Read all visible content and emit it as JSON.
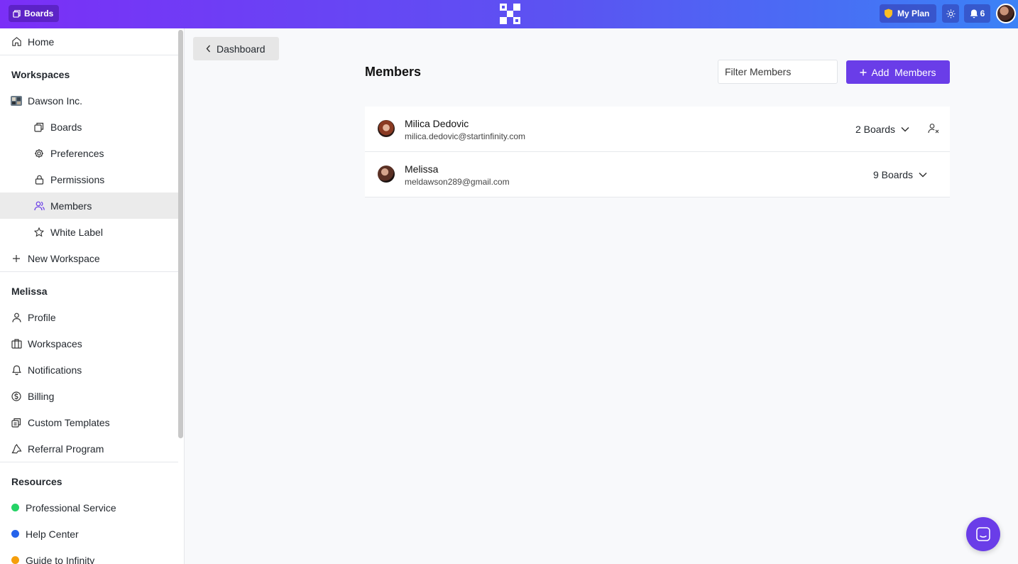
{
  "topbar": {
    "boards_label": "Boards",
    "my_plan_label": "My Plan",
    "notification_count": "6"
  },
  "sidebar": {
    "home": "Home",
    "workspaces_heading": "Workspaces",
    "workspace_name": "Dawson Inc.",
    "workspace_items": [
      {
        "label": "Boards",
        "icon": "boards-icon"
      },
      {
        "label": "Preferences",
        "icon": "gear-icon"
      },
      {
        "label": "Permissions",
        "icon": "lock-icon"
      },
      {
        "label": "Members",
        "icon": "users-icon",
        "active": true
      },
      {
        "label": "White Label",
        "icon": "star-icon"
      }
    ],
    "new_workspace": "New Workspace",
    "user_heading": "Melissa",
    "user_items": [
      {
        "label": "Profile",
        "icon": "user-icon"
      },
      {
        "label": "Workspaces",
        "icon": "building-icon"
      },
      {
        "label": "Notifications",
        "icon": "bell-icon"
      },
      {
        "label": "Billing",
        "icon": "dollar-icon"
      },
      {
        "label": "Custom Templates",
        "icon": "templates-icon"
      },
      {
        "label": "Referral Program",
        "icon": "recycle-icon"
      }
    ],
    "resources_heading": "Resources",
    "resources_items": [
      {
        "label": "Professional Service",
        "icon": "whatsapp-icon",
        "color": "#25d366"
      },
      {
        "label": "Help Center",
        "icon": "help-icon",
        "color": "#2563eb"
      },
      {
        "label": "Guide to Infinity",
        "icon": "guide-icon",
        "color": "#f59e0b"
      }
    ]
  },
  "main": {
    "back_button": "Dashboard",
    "title": "Members",
    "filter_placeholder": "Filter Members",
    "add_button": "Add  Members",
    "members": [
      {
        "name": "Milica Dedovic",
        "email": "milica.dedovic@startinfinity.com",
        "boards": "2 Boards"
      },
      {
        "name": "Melissa",
        "email": "meldawson289@gmail.com",
        "boards": "9 Boards"
      }
    ]
  },
  "colors": {
    "accent": "#6a3de8",
    "topbar_start": "#7b2ff7",
    "topbar_end": "#3b82f6"
  }
}
